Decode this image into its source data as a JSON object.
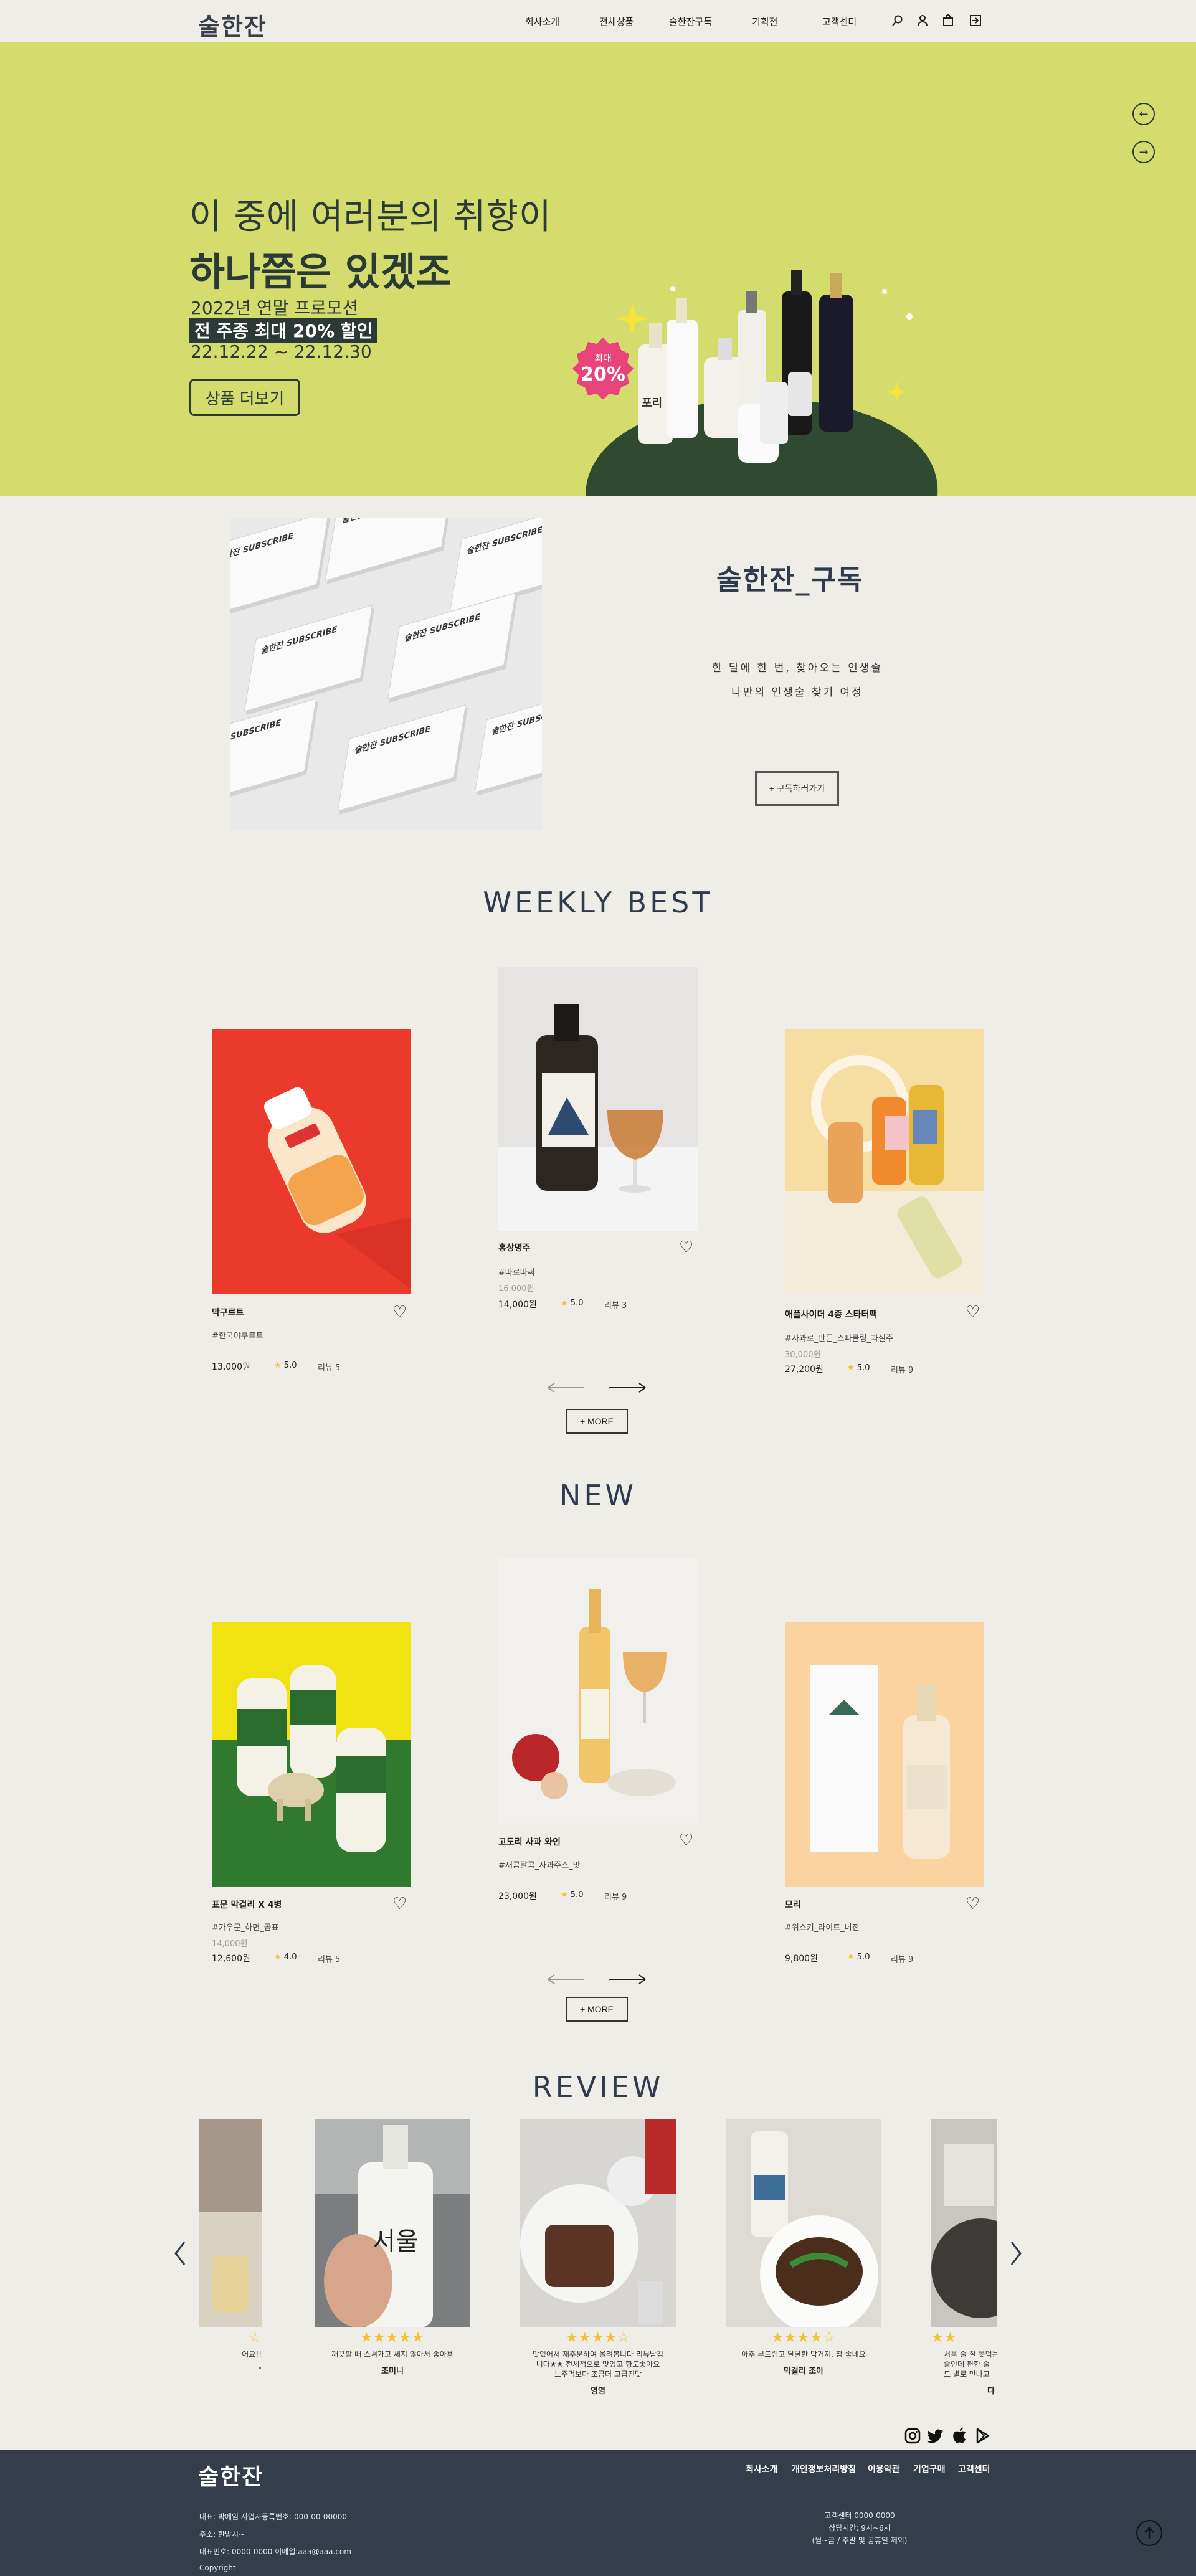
{
  "header": {
    "logo": "술한잔",
    "nav": [
      "회사소개",
      "전체상품",
      "술한잔구독",
      "기획전",
      "고객센터"
    ],
    "icons": [
      "search-icon",
      "user-icon",
      "bag-icon",
      "logout-icon"
    ]
  },
  "hero": {
    "line1": "이 중에 여러분의 취향이",
    "line2": "하나쯤은 있겠조",
    "promo1": "2022년 연말 프로모션",
    "promo2": "전 주종 최대 20% 할인",
    "promo3": "22.12.22 ~ 22.12.30",
    "button": "상품 더보기",
    "badge_top": "최대",
    "badge_bottom": "20%",
    "label_small": "포리",
    "bg_color": "#d3dc6d"
  },
  "subscribe": {
    "title": "술한잔_구독",
    "line1": "한 달에 한 번, 찾아오는 인생술",
    "line2": "나만의 인생술 찾기 여정",
    "button": "+ 구독하러가기",
    "box_label": "술한잔 SUBSCRIBE"
  },
  "weekly": {
    "title": "WEEKLY BEST",
    "more": "+ MORE",
    "items": [
      {
        "name": "막구르트",
        "tag": "#한국야쿠르트",
        "old_price": "",
        "price": "13,000원",
        "rating": "5.0",
        "reviews": "리뷰 5"
      },
      {
        "name": "홍상명주",
        "tag": "#따로따써",
        "old_price": "16,000원",
        "price": "14,000원",
        "rating": "5.0",
        "reviews": "리뷰 3"
      },
      {
        "name": "애플사이더 4종 스타터팩",
        "tag": "#사과로_만든_스파클링_과실주",
        "old_price": "30,000원",
        "price": "27,200원",
        "rating": "5.0",
        "reviews": "리뷰 9"
      }
    ]
  },
  "new": {
    "title": "NEW",
    "more": "+ MORE",
    "items": [
      {
        "name": "표문 막걸리 X 4병",
        "tag": "#가우문_하면_곰표",
        "old_price": "14,000원",
        "price": "12,600원",
        "rating": "4.0",
        "reviews": "리뷰 5"
      },
      {
        "name": "고도리 사과 와인",
        "tag": "#새콤달콤_사과주스_맛",
        "old_price": "",
        "price": "23,000원",
        "rating": "5.0",
        "reviews": "리뷰 9"
      },
      {
        "name": "모리",
        "tag": "#위스키_라이트_버전",
        "old_price": "",
        "price": "9,800원",
        "rating": "5.0",
        "reviews": "리뷰 9"
      }
    ]
  },
  "reviews": {
    "title": "REVIEW",
    "items": [
      {
        "stars": "☆",
        "text": "어요!!",
        "name": "·"
      },
      {
        "stars": "★★★★★",
        "text": "깨끗할 때 스쳐가고 세지 않아서 좋아용",
        "name": "조미니"
      },
      {
        "stars": "★★★★☆",
        "text": "맛있어서 재주문하여 올려봅니다 리뷰남김\n니다★★ 전체적으로 맛있고 향도좋아요\n노주먹보다 조금더 고급진맛",
        "name": "영영"
      },
      {
        "stars": "★★★★☆",
        "text": "아주 부드럽고 달달한 막거지. 참 좋네요",
        "name": "막걸리 조아"
      },
      {
        "stars": "★★",
        "text": "처음 술 잘 못먹는\n술인데 편한 술\n도 별로 만나고",
        "name": "다"
      }
    ]
  },
  "social": [
    "instagram-icon",
    "twitter-icon",
    "apple-icon",
    "play-store-icon"
  ],
  "footer": {
    "logo": "술한잔",
    "nav": [
      "회사소개",
      "개인정보처리방침",
      "이용약관",
      "기업구매",
      "고객센터"
    ],
    "info1": "대표: 박예임 사업자등록번호: 000-00-00000",
    "info2": "주소: 한밭시~",
    "info3": "대표번호: 0000-0000 이메일:aaa@aaa.com",
    "info4": "Copyright",
    "cs1": "고객센터 0000-0000",
    "cs2": "상담시간: 9시~6시",
    "cs3": "(월~금 / 주말 및 공휴일 제외)"
  }
}
